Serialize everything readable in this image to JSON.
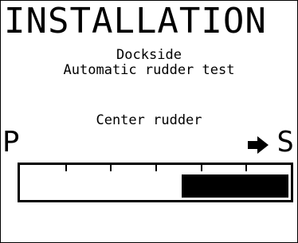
{
  "screen": {
    "title": "INSTALLATION",
    "subtitle_line1": "Dockside",
    "subtitle_line2": "Automatic rudder test",
    "prompt": "Center rudder"
  },
  "rudder_indicator": {
    "port_label": "P",
    "starboard_label": "S",
    "direction_icon": "arrow-right-icon",
    "tick_count": 5,
    "fill_start_fraction": 0.6,
    "fill_end_fraction": 1.0
  },
  "colors": {
    "foreground": "#000000",
    "background": "#ffffff"
  }
}
